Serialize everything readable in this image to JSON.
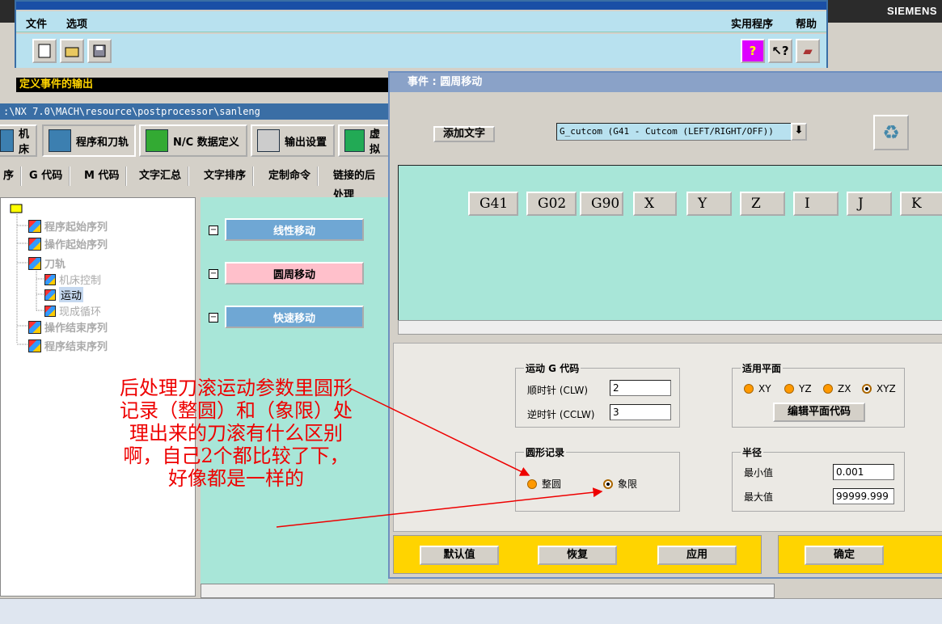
{
  "brand": "SIEMENS",
  "menu": {
    "file": "文件",
    "options": "选项",
    "utilities": "实用程序",
    "help": "帮助"
  },
  "event_bar": "定义事件的输出",
  "path": ":\\NX 7.0\\MACH\\resource\\postprocessor\\sanleng",
  "main_tabs": [
    "机床",
    "程序和刀轨",
    "N/C 数据定义",
    "输出设置",
    "虚拟"
  ],
  "sub_tabs": [
    "序",
    "G 代码",
    "M 代码",
    "文字汇总",
    "文字排序",
    "定制命令",
    "链接的后处理"
  ],
  "tree": [
    "程序起始序列",
    "操作起始序列",
    "刀轨",
    "机床控制",
    "运动",
    "现成循环",
    "操作结束序列",
    "程序结束序列"
  ],
  "events": {
    "linear": "线性移动",
    "circular": "圆周移动",
    "rapid": "快速移动"
  },
  "dialog": {
    "title": "事件 : 圆周移动",
    "add_text": "添加文字",
    "combo": "G_cutcom (G41 - Cutcom (LEFT/RIGHT/OFF))",
    "blocks": [
      "G41",
      "G02",
      "G90",
      "X",
      "Y",
      "Z",
      "I",
      "J",
      "K"
    ],
    "motion_group": "运动 G 代码",
    "clw_label": "顺时针 (CLW)",
    "clw_value": "2",
    "cclw_label": "逆时针 (CCLW)",
    "cclw_value": "3",
    "plane_group": "适用平面",
    "planes": [
      "XY",
      "YZ",
      "ZX",
      "XYZ"
    ],
    "edit_plane": "编辑平面代码",
    "circle_group": "圆形记录",
    "full": "整圆",
    "quadrant": "象限",
    "radius_group": "半径",
    "min_label": "最小值",
    "min_value": "0.001",
    "max_label": "最大值",
    "max_value": "99999.999",
    "default": "默认值",
    "restore": "恢复",
    "apply": "应用",
    "ok": "确定"
  },
  "annotation": "后处理刀滚运动参数里圆形记录（整圆）和（象限）处理出来的刀滚有什么区别啊，自己2个都比较了下，好像都是一样的"
}
